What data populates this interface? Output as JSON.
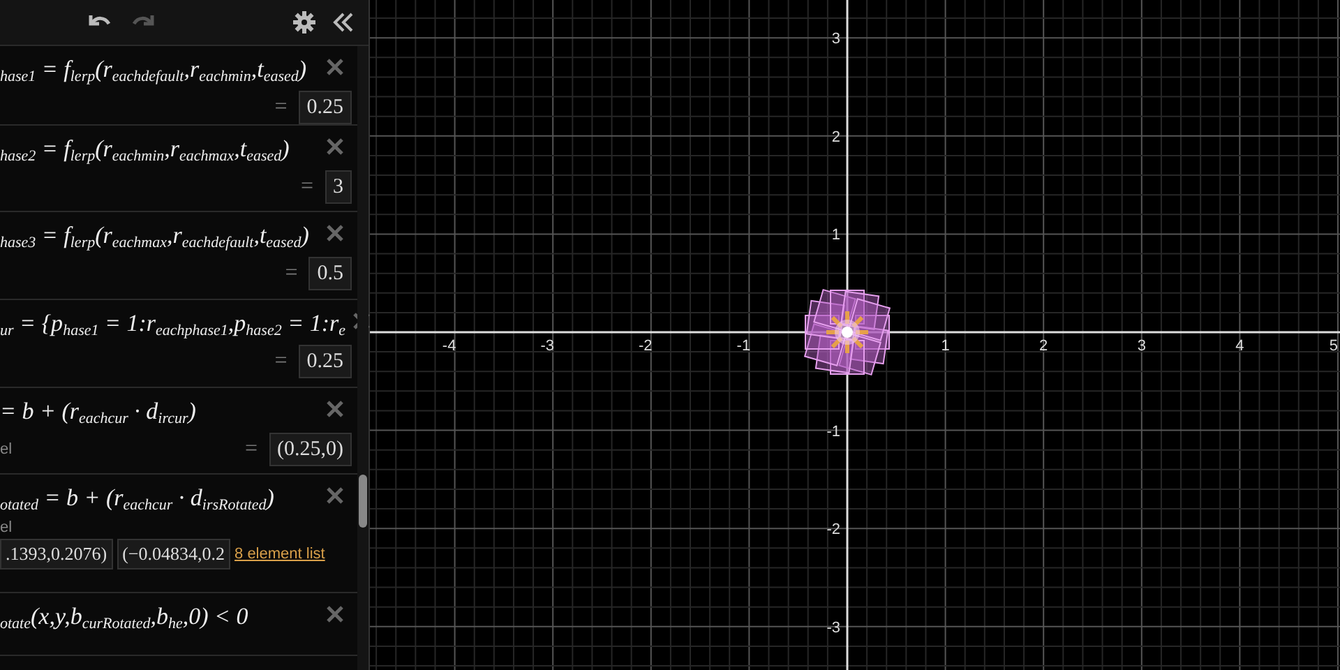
{
  "toolbar": {
    "buttons": [
      {
        "kind": "undo",
        "disabled": false
      },
      {
        "kind": "redo",
        "disabled": true
      },
      {
        "kind": "settings",
        "disabled": false
      },
      {
        "kind": "collapse",
        "disabled": false
      }
    ]
  },
  "expressions": [
    {
      "formula": "$_{hase1}$ = f$_{lerp}$(r$_{eachdefault}$,r$_{eachmin}$,t$_{eased}$)",
      "result": "0.25"
    },
    {
      "formula": "$_{hase2}$ = f$_{lerp}$(r$_{eachmin}$,r$_{eachmax}$,t$_{eased}$)",
      "result": "3"
    },
    {
      "formula": "$_{hase3}$ = f$_{lerp}$(r$_{eachmax}$,r$_{eachdefault}$,t$_{eased}$)",
      "result": "0.5"
    },
    {
      "formula": "$_{ur}$ = {p$_{hase1}$ = 1:r$_{eachphase1}$,p$_{hase2}$ = 1:r$_{e}$",
      "result": "0.25"
    },
    {
      "formula": "= b + (r$_{eachcur}$ · d$_{ircur}$)",
      "label": "el",
      "result": "(0.25,0)"
    },
    {
      "formula": "$_{otated}$ = b + (r$_{eachcur}$ · d$_{irsRotated}$)",
      "label": "el",
      "list_values": [
        ".1393,0.2076)",
        "(−0.04834,0.2"
      ],
      "list_link": "8 element list"
    },
    {
      "formula": "$_{otate}$(x,y,b$_{curRotated}$,b$_{he}$,0) < 0"
    }
  ],
  "equals_sign": "=",
  "graph": {
    "x_tick_labels": [
      "-4",
      "-3",
      "-2",
      "-1",
      "1",
      "2",
      "3",
      "4",
      "5"
    ],
    "y_tick_labels": [
      "3",
      "2",
      "1",
      "-1",
      "-2",
      "-3"
    ]
  }
}
